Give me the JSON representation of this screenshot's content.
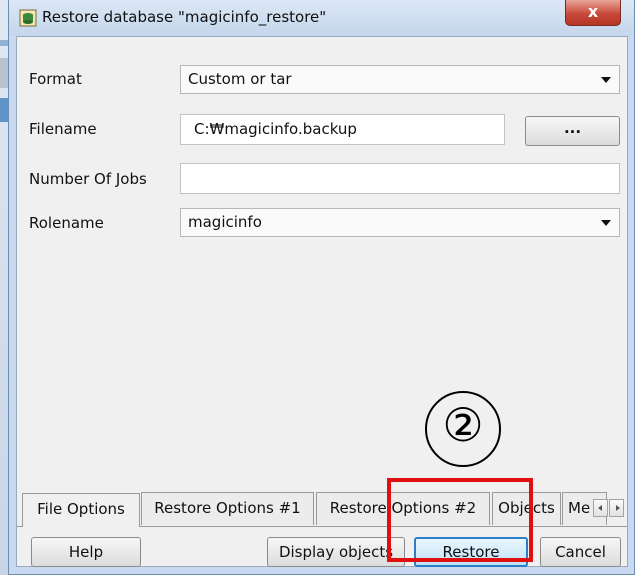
{
  "window": {
    "title": "Restore database \"magicinfo_restore\"",
    "close_label": "x"
  },
  "fields": {
    "format": {
      "label": "Format",
      "value": "Custom or tar"
    },
    "filename": {
      "label": "Filename",
      "value": "C:₩magicinfo.backup",
      "browse_label": "..."
    },
    "jobs": {
      "label": "Number Of Jobs",
      "value": ""
    },
    "rolename": {
      "label": "Rolename",
      "value": "magicinfo"
    }
  },
  "tabs": [
    {
      "label": "File Options",
      "active": true
    },
    {
      "label": "Restore Options #1"
    },
    {
      "label": "Restore Options #2"
    },
    {
      "label": "Objects"
    },
    {
      "label": "Me"
    }
  ],
  "buttons": {
    "help": "Help",
    "display_objects": "Display objects",
    "restore": "Restore",
    "cancel": "Cancel"
  },
  "annotation": {
    "step_marker": "②",
    "highlight_color": "#e01010"
  }
}
